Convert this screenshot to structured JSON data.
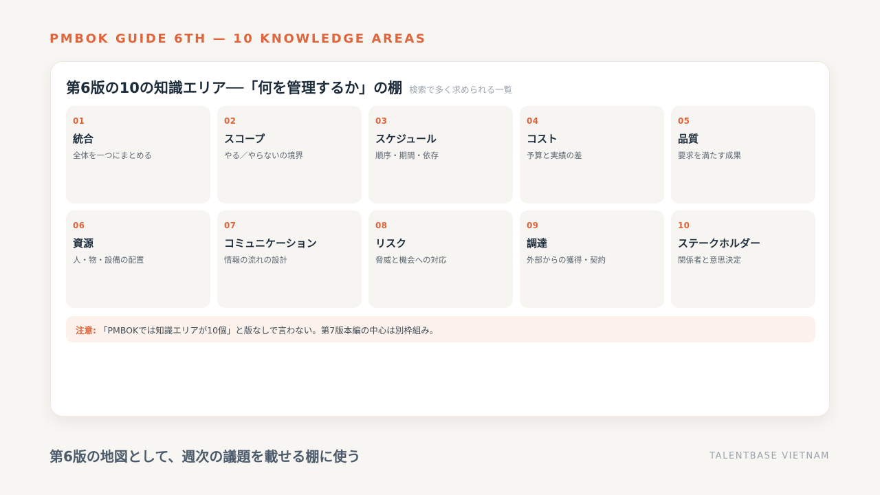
{
  "header": {
    "eyebrow": "PMBOK GUIDE 6TH — 10 KNOWLEDGE AREAS"
  },
  "card": {
    "title": "第6版の10の知識エリア──「何を管理するか」の棚",
    "subtitle": "検索で多く求められる一覧"
  },
  "areas": [
    {
      "num": "01",
      "name": "統合",
      "desc": "全体を一つにまとめる"
    },
    {
      "num": "02",
      "name": "スコープ",
      "desc": "やる／やらないの境界"
    },
    {
      "num": "03",
      "name": "スケジュール",
      "desc": "順序・期間・依存"
    },
    {
      "num": "04",
      "name": "コスト",
      "desc": "予算と実績の差"
    },
    {
      "num": "05",
      "name": "品質",
      "desc": "要求を満たす成果"
    },
    {
      "num": "06",
      "name": "資源",
      "desc": "人・物・設備の配置"
    },
    {
      "num": "07",
      "name": "コミュニケーション",
      "desc": "情報の流れの設計"
    },
    {
      "num": "08",
      "name": "リスク",
      "desc": "脅威と機会への対応"
    },
    {
      "num": "09",
      "name": "調達",
      "desc": "外部からの獲得・契約"
    },
    {
      "num": "10",
      "name": "ステークホルダー",
      "desc": "関係者と意思決定"
    }
  ],
  "note": {
    "label": "注意:",
    "text": "「PMBOKでは知識エリアが10個」と版なしで言わない。第7版本編の中心は別枠組み。"
  },
  "footer": {
    "caption": "第6版の地図として、週次の議題を載せる棚に使う",
    "brand": "TALENTBASE VIETNAM"
  },
  "colors": {
    "accent": "#e0643c",
    "background": "#f8f6f3",
    "card": "#ffffff",
    "tile": "#f7f5f2",
    "note_bg": "#fdf1ec",
    "text_dark": "#1c2b3a"
  }
}
